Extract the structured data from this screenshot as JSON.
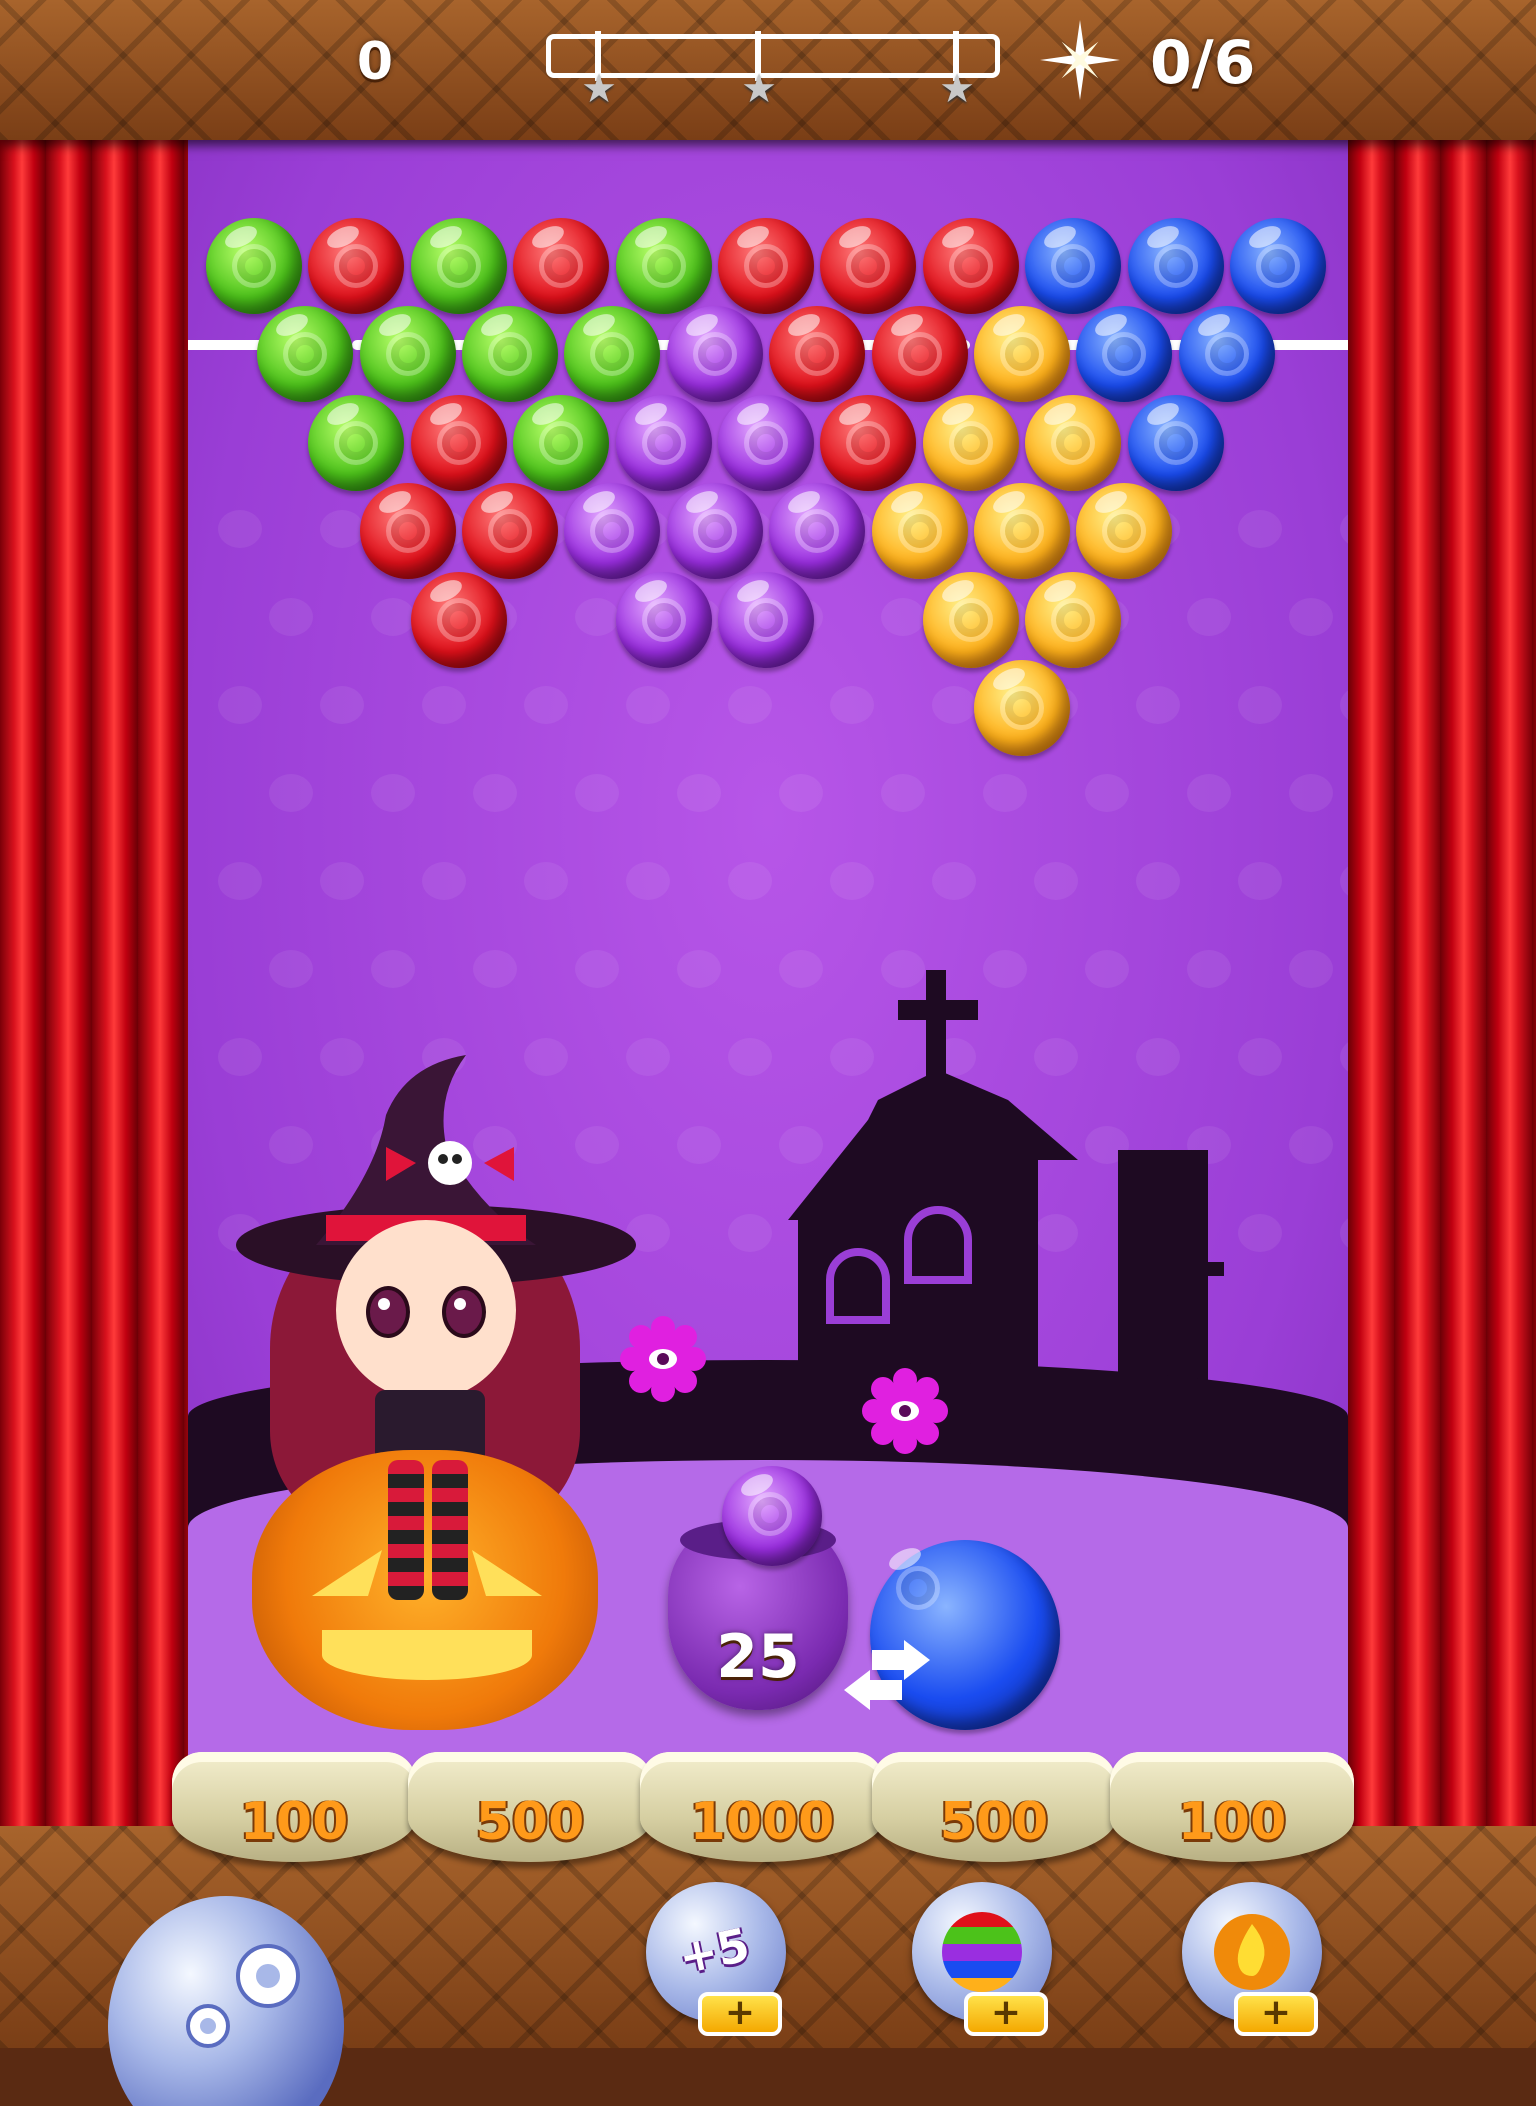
{
  "hud": {
    "score": "0",
    "goal_progress": "0/6",
    "star_progress_fraction": 0,
    "stars_earned": 0
  },
  "board": {
    "rows": [
      [
        "green",
        "red",
        "green",
        "red",
        "green",
        "red",
        "red",
        "red",
        "blue",
        "blue",
        "blue"
      ],
      [
        "green",
        "green",
        "green",
        "green",
        "purple",
        "red",
        "red",
        "orange",
        "blue",
        "blue"
      ],
      [
        "green",
        "red",
        "green",
        "purple",
        "purple",
        "red",
        "orange",
        "orange",
        "blue"
      ],
      [
        "red",
        "red",
        "purple",
        "purple",
        "purple",
        "orange",
        "orange",
        "orange"
      ],
      [
        "red",
        "purple",
        "purple",
        "orange",
        "orange"
      ],
      [
        "orange"
      ]
    ],
    "colors": {
      "green": "#4cc21a",
      "red": "#e0101a",
      "blue": "#1a4cf0",
      "purple": "#9a2ee0",
      "orange": "#ffb01a"
    }
  },
  "shooter": {
    "shots_left": "25",
    "current_bubble": "blue",
    "next_bubble": "purple"
  },
  "buckets": [
    "100",
    "500",
    "1000",
    "500",
    "100"
  ],
  "boosters": [
    {
      "name": "extra-moves",
      "label": "+5",
      "icon": "candy-bubbles-icon"
    },
    {
      "name": "rainbow",
      "label": "",
      "icon": "rainbow-bubble-icon"
    },
    {
      "name": "fireball",
      "label": "",
      "icon": "fire-bubble-icon"
    }
  ]
}
